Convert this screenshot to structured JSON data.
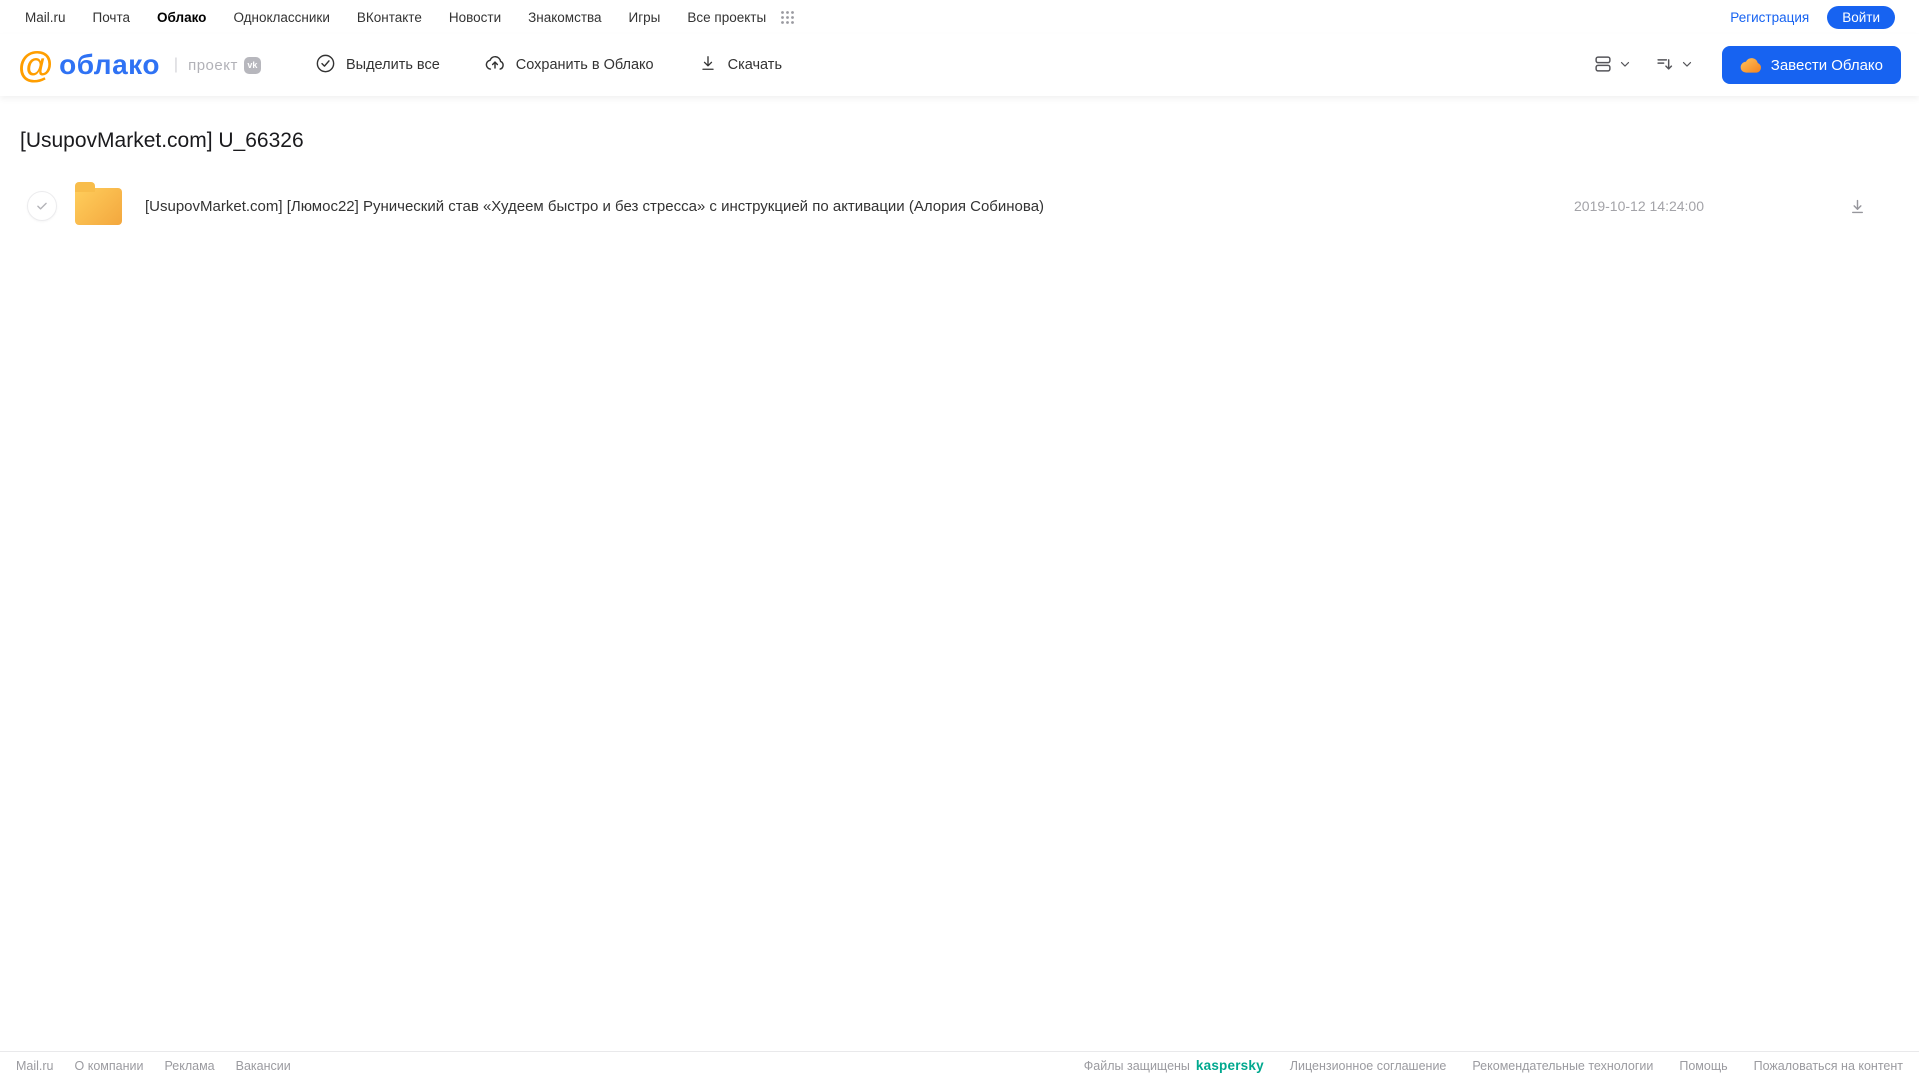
{
  "colors": {
    "accent_blue": "#1763F1",
    "logo_blue": "#2F72F4",
    "logo_orange": "#FF9E00",
    "folder_yellow": "#F7B64A",
    "kaspersky_green": "#00A88E"
  },
  "portal_nav": {
    "links": [
      {
        "label": "Mail.ru"
      },
      {
        "label": "Почта"
      },
      {
        "label": "Облако",
        "active": true
      },
      {
        "label": "Одноклассники"
      },
      {
        "label": "ВКонтакте"
      },
      {
        "label": "Новости"
      },
      {
        "label": "Знакомства"
      },
      {
        "label": "Игры"
      },
      {
        "label": "Все проекты"
      }
    ],
    "registration_label": "Регистрация",
    "login_label": "Войти"
  },
  "header": {
    "logo_at": "@",
    "logo_text": "облако",
    "project_label": "проект",
    "vk_label": "vk",
    "toolbar": {
      "select_all_label": "Выделить все",
      "save_label": "Сохранить в Облако",
      "download_label": "Скачать"
    },
    "create_cloud_label": "Завести Облако"
  },
  "main": {
    "title": "[UsupovMarket.com] U_66326",
    "files": [
      {
        "type": "folder",
        "name": "[UsupovMarket.com] [Люмос22] Рунический став «Худеем быстро и без стресса» с инструкцией по активации (Алория Собинова)",
        "date": "2019-10-12 14:24:00"
      }
    ]
  },
  "footer": {
    "left_links": [
      "Mail.ru",
      "О компании",
      "Реклама",
      "Вакансии"
    ],
    "protected_label": "Файлы защищены",
    "kaspersky_label": "kaspersky",
    "right_links": [
      "Лицензионное соглашение",
      "Рекомендательные технологии",
      "Помощь",
      "Пожаловаться на контент"
    ]
  }
}
